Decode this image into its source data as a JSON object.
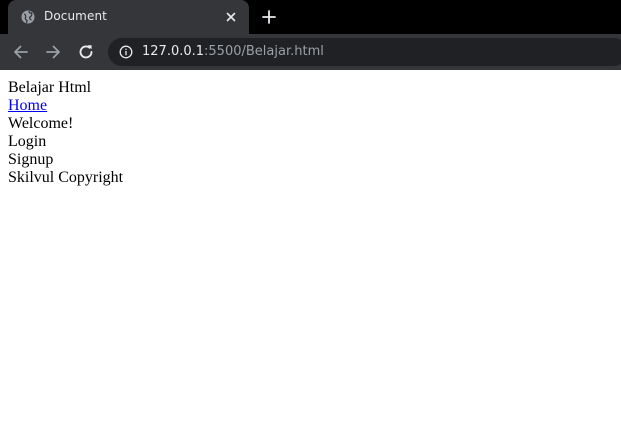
{
  "browser": {
    "tab": {
      "title": "Document"
    },
    "address": {
      "host": "127.0.0.1",
      "rest": ":5500/Belajar.html"
    }
  },
  "page": {
    "title_text": "Belajar Html",
    "home_link": "Home",
    "welcome": "Welcome!",
    "login": "Login",
    "signup": "Signup",
    "footer": "Skilvul Copyright"
  },
  "colors": {
    "chrome_dark": "#35363a",
    "tab_strip": "#000000",
    "omnibox": "#202124",
    "link": "#0000ee"
  },
  "icons": {
    "favicon": "globe-icon",
    "close": "close-icon",
    "new_tab": "plus-icon",
    "back": "arrow-left-icon",
    "forward": "arrow-right-icon",
    "reload": "reload-icon",
    "site_info": "info-icon"
  }
}
